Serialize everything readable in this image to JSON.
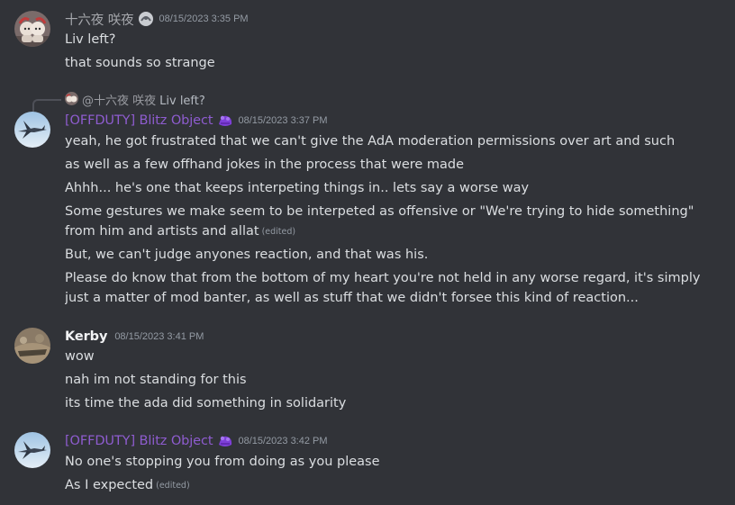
{
  "messages": [
    {
      "author": "十六夜 咲夜",
      "timestamp": "08/15/2023 3:35 PM",
      "lines": [
        "Liv left?",
        "that sounds so strange"
      ]
    },
    {
      "reply": {
        "mention": "@十六夜 咲夜",
        "text": "Liv left?"
      },
      "author": "[OFFDUTY] Blitz Object",
      "timestamp": "08/15/2023 3:37 PM",
      "lines": [
        "yeah, he got frustrated that we can't give the AdA moderation permissions over art and such",
        "as well as a few offhand jokes in the process that were made",
        "Ahhh... he's one that keeps interpeting things in.. lets say a worse way",
        "Some gestures we make seem to be interpeted as offensive or \"We're trying to hide something\" from him and artists and allat",
        "But, we can't judge anyones reaction, and that was his.",
        "Please do know that from the bottom of my heart you're not held in any worse regard, it's simply just a matter of mod banter, as well as stuff that we didn't forsee this kind of reaction..."
      ],
      "edited_label": "(edited)"
    },
    {
      "author": "Kerby",
      "timestamp": "08/15/2023 3:41 PM",
      "lines": [
        "wow",
        "nah im not standing for this",
        "its time the ada did something in solidarity"
      ]
    },
    {
      "author": "[OFFDUTY] Blitz Object",
      "timestamp": "08/15/2023 3:42 PM",
      "lines": [
        "No one's stopping you from doing as you please",
        "As I expected"
      ],
      "edited_label": "(edited)"
    }
  ],
  "colors": {
    "background": "#313338",
    "text": "#dbdee1",
    "timestamp": "#949ba4",
    "purple_role": "#8e5ccf"
  },
  "icons": [
    "avatar-sakuya",
    "role-badge-icon",
    "avatar-blitz-jet",
    "avatar-kerby"
  ]
}
